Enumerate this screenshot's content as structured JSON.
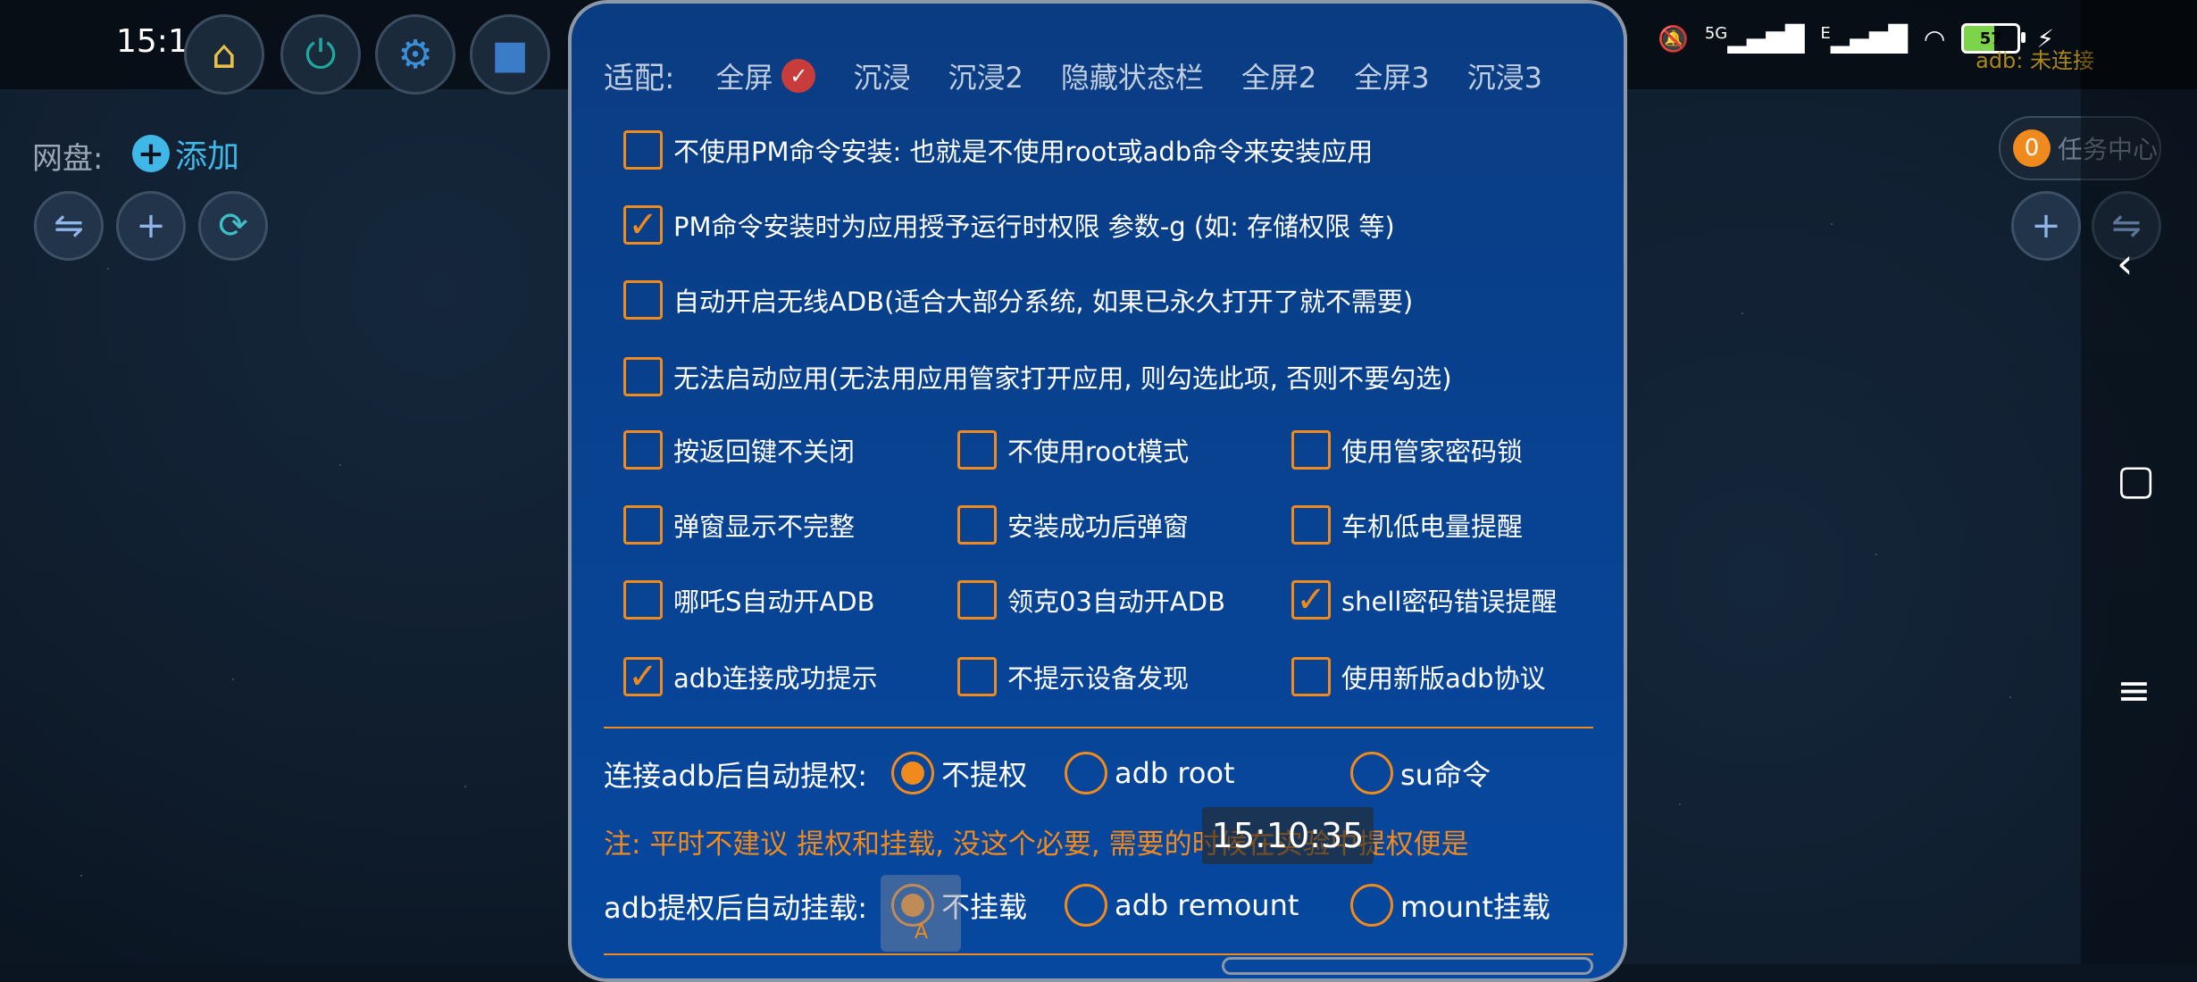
{
  "status": {
    "time": "15:10",
    "network_5g": "5G",
    "network_e": "E",
    "battery": "57",
    "adb_status": "adb: 未连接"
  },
  "left": {
    "netdisk_label": "网盘:",
    "add_label": "添加"
  },
  "right": {
    "task_count": "0",
    "task_center": "任务中心"
  },
  "dialog": {
    "adapt_label": "适配:",
    "adapt_tabs": [
      "全屏",
      "沉浸",
      "沉浸2",
      "隐藏状态栏",
      "全屏2",
      "全屏3",
      "沉浸3"
    ],
    "options_full": [
      {
        "label": "不使用PM命令安装: 也就是不使用root或adb命令来安装应用",
        "checked": false
      },
      {
        "label": "PM命令安装时为应用授予运行时权限 参数-g (如: 存储权限 等)",
        "checked": true
      },
      {
        "label": "自动开启无线ADB(适合大部分系统, 如果已永久打开了就不需要)",
        "checked": false
      },
      {
        "label": "无法启动应用(无法用应用管家打开应用, 则勾选此项, 否则不要勾选)",
        "checked": false
      }
    ],
    "grid": [
      [
        "按返回键不关闭",
        "不使用root模式",
        "使用管家密码锁"
      ],
      [
        "弹窗显示不完整",
        "安装成功后弹窗",
        "车机低电量提醒"
      ],
      [
        "哪吒S自动开ADB",
        "领克03自动开ADB",
        "shell密码错误提醒"
      ],
      [
        "adb连接成功提示",
        "不提示设备发现",
        "使用新版adb协议"
      ]
    ],
    "escalate_label": "连接adb后自动提权:",
    "escalate_options": [
      "不提权",
      "adb root",
      "su命令"
    ],
    "note": "注: 平时不建议 提权和挂载, 没这个必要, 需要的时候在实验中提权便是",
    "mount_label": "adb提权后自动挂载:",
    "mount_options": [
      "不挂载",
      "adb remount",
      "mount挂载"
    ],
    "overlay_time": "15:10:35",
    "float_letter": "A"
  },
  "colors": {
    "accent": "#f08a1c",
    "dialog_bg": "#0648a0"
  }
}
